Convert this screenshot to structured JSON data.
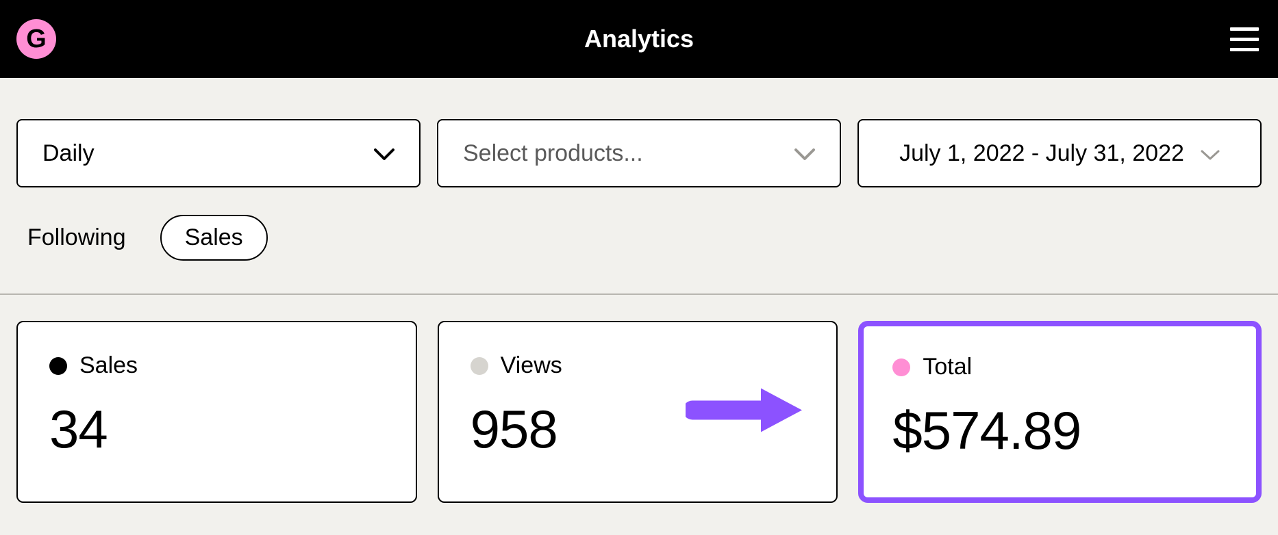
{
  "header": {
    "logo_letter": "G",
    "title": "Analytics"
  },
  "filters": {
    "granularity": {
      "value": "Daily"
    },
    "products": {
      "placeholder": "Select products..."
    },
    "date_range": {
      "value": "July 1, 2022 - July 31, 2022"
    }
  },
  "tabs": {
    "following": "Following",
    "sales": "Sales",
    "active": "sales"
  },
  "stats": {
    "sales": {
      "label": "Sales",
      "value": "34",
      "dot": "#000000"
    },
    "views": {
      "label": "Views",
      "value": "958",
      "dot": "#d6d4cf"
    },
    "total": {
      "label": "Total",
      "value": "$574.89",
      "dot": "#ff8ed4",
      "highlighted": true
    }
  },
  "colors": {
    "accent_purple": "#8c52ff",
    "brand_pink": "#ff8ed4"
  }
}
